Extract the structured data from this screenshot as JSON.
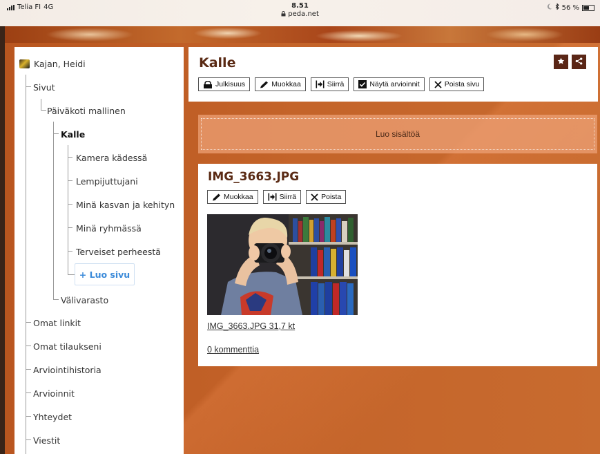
{
  "status_bar": {
    "carrier": "Telia FI",
    "network": "4G",
    "time": "8.51",
    "url": "peda.net",
    "battery": "56 %",
    "battery_level": 0.56
  },
  "sidebar": {
    "owner": "Kajan, Heidi",
    "tree": [
      {
        "label": "Sivut"
      },
      {
        "label": "Päiväkoti mallinen"
      },
      {
        "label": "Kalle",
        "current": true
      },
      {
        "label": "Kamera kädessä"
      },
      {
        "label": "Lempijuttujani"
      },
      {
        "label": "Minä kasvan ja kehityn"
      },
      {
        "label": "Minä ryhmässä"
      },
      {
        "label": "Terveiset perheestä"
      },
      {
        "label": "Välivarasto"
      },
      {
        "label": "Omat linkit"
      },
      {
        "label": "Omat tilaukseni"
      },
      {
        "label": "Arviointihistoria"
      },
      {
        "label": "Arvioinnit"
      },
      {
        "label": "Yhteydet"
      },
      {
        "label": "Viestit"
      }
    ],
    "create_page": "+ Luo sivu"
  },
  "header": {
    "title": "Kalle",
    "toolbar": {
      "publicity": "Julkisuus",
      "edit": "Muokkaa",
      "move": "Siirrä",
      "show_ratings": "Näytä arvioinnit",
      "delete_page": "Poista sivu"
    }
  },
  "content": {
    "create_content": "Luo sisältöä",
    "image_item": {
      "title": "IMG_3663.JPG",
      "edit": "Muokkaa",
      "move": "Siirrä",
      "delete": "Poista",
      "file_link": "IMG_3663.JPG 31,7 kt",
      "comments": "0 kommenttia"
    }
  },
  "colors": {
    "brand_brown": "#5a2616",
    "link_blue": "#3b8ad9",
    "accent_orange": "#c4642a"
  }
}
